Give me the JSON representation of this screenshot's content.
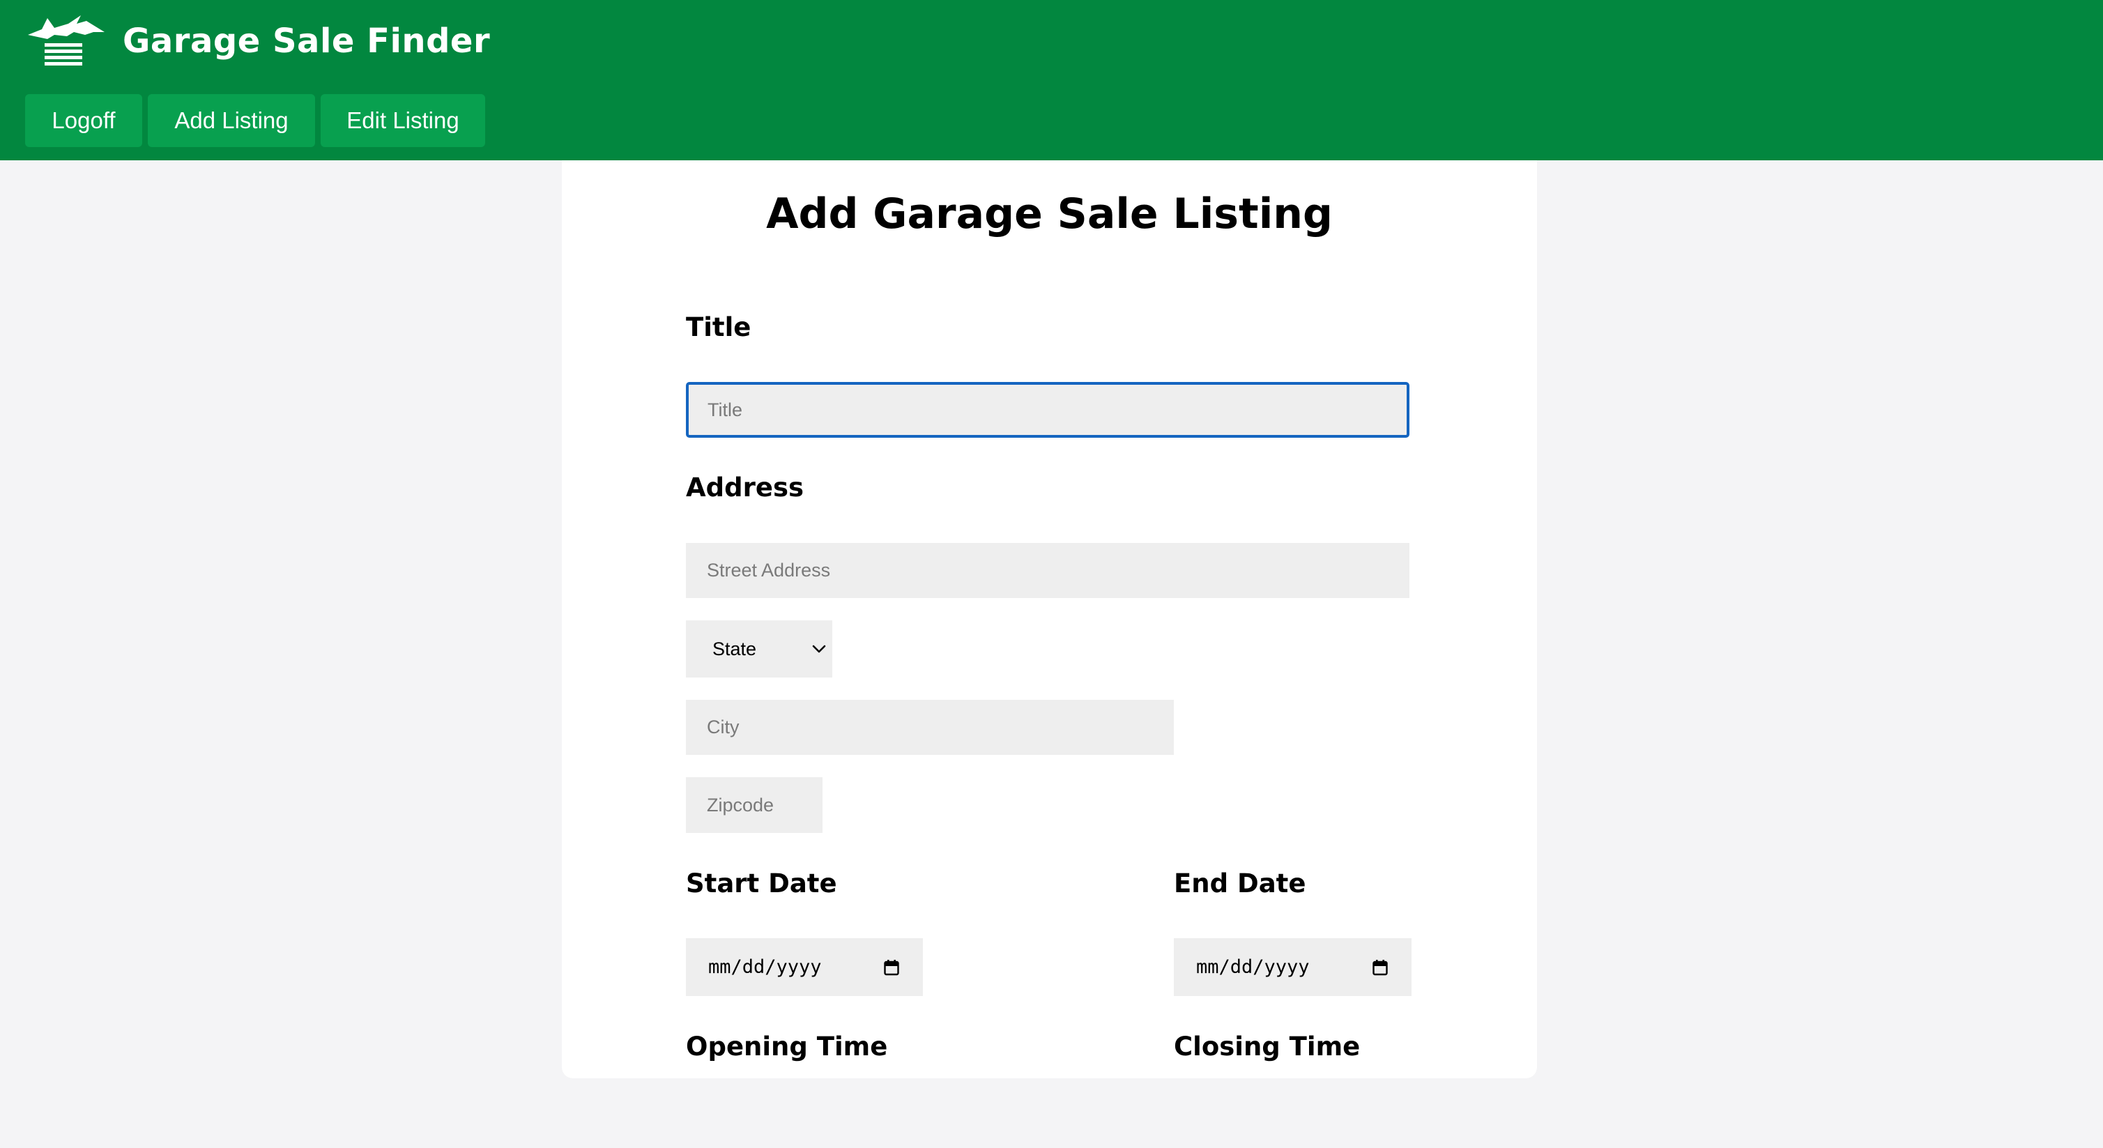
{
  "app": {
    "name": "Garage Sale Finder",
    "logo_icon": "garage-bird-logo-icon"
  },
  "nav": {
    "items": [
      {
        "label": "Logoff"
      },
      {
        "label": "Add Listing"
      },
      {
        "label": "Edit Listing"
      }
    ]
  },
  "page": {
    "title": "Add Garage Sale Listing"
  },
  "form": {
    "title_label": "Title",
    "title_placeholder": "Title",
    "address_label": "Address",
    "street_placeholder": "Street Address",
    "state_value": "State",
    "city_placeholder": "City",
    "zipcode_placeholder": "Zipcode",
    "start_date_label": "Start Date",
    "start_date_value": "mm/dd/yyyy",
    "end_date_label": "End Date",
    "end_date_value": "mm/dd/yyyy",
    "opening_time_label": "Opening Time",
    "closing_time_label": "Closing Time"
  },
  "colors": {
    "header_bg": "#02873f",
    "nav_button_bg": "#08a04f",
    "page_bg": "#f4f4f6",
    "input_bg": "#eeeeee",
    "focus_border": "#1565c0"
  }
}
